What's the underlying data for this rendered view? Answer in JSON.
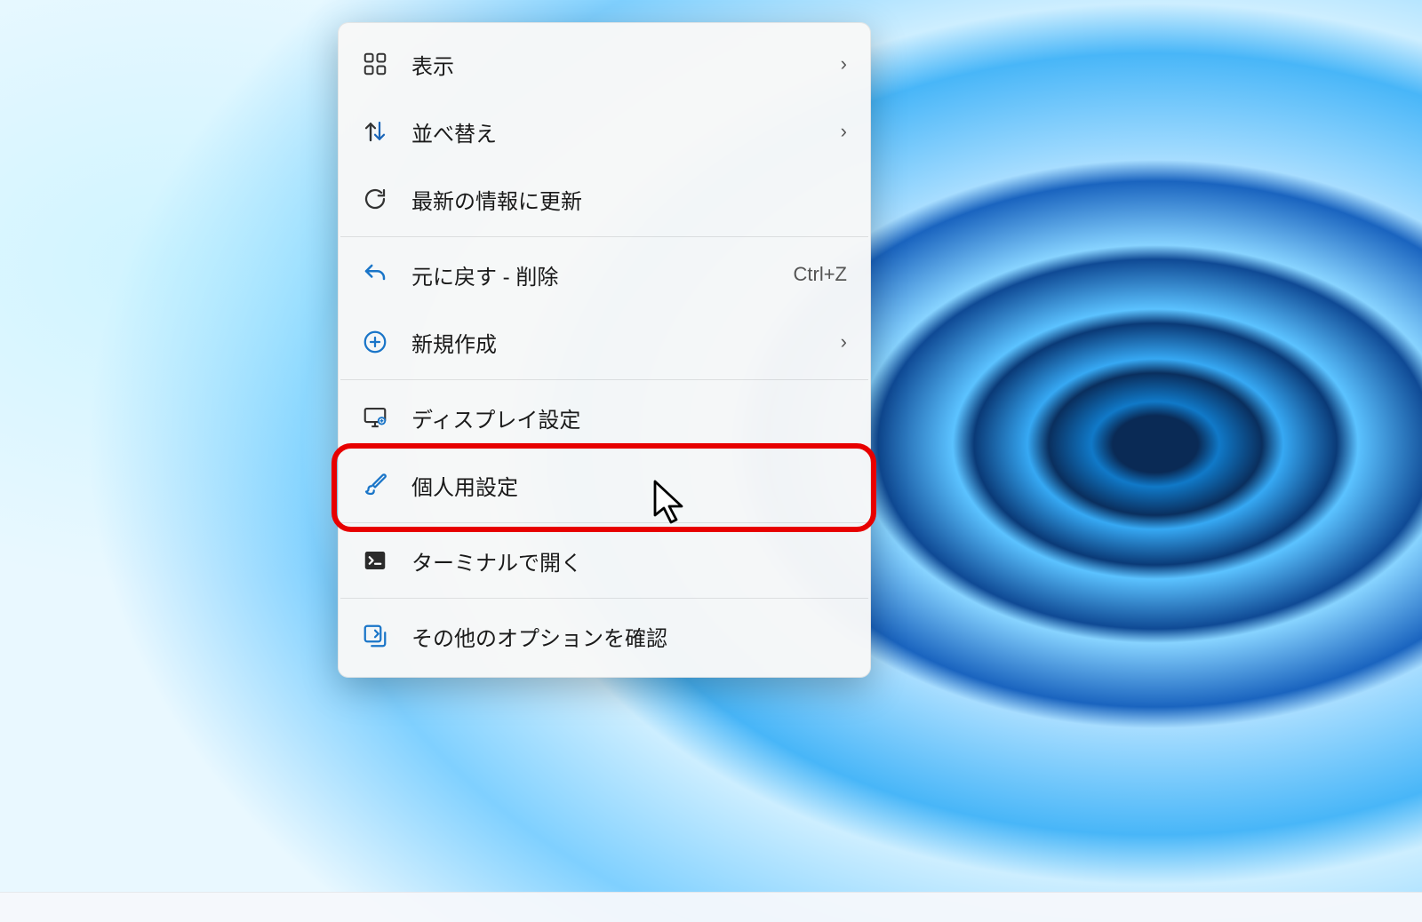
{
  "context_menu": {
    "items": [
      {
        "icon": "view-icon",
        "label": "表示",
        "has_submenu": true
      },
      {
        "icon": "sort-icon",
        "label": "並べ替え",
        "has_submenu": true
      },
      {
        "icon": "refresh-icon",
        "label": "最新の情報に更新"
      },
      {
        "separator": true
      },
      {
        "icon": "undo-icon",
        "label": "元に戻す - 削除",
        "shortcut": "Ctrl+Z"
      },
      {
        "icon": "new-icon",
        "label": "新規作成",
        "has_submenu": true
      },
      {
        "separator": true
      },
      {
        "icon": "display-icon",
        "label": "ディスプレイ設定"
      },
      {
        "icon": "brush-icon",
        "label": "個人用設定",
        "highlighted": true
      },
      {
        "separator": true
      },
      {
        "icon": "terminal-icon",
        "label": "ターミナルで開く"
      },
      {
        "separator": true
      },
      {
        "icon": "more-icon",
        "label": "その他のオプションを確認"
      }
    ]
  },
  "chevron_glyph": "›"
}
